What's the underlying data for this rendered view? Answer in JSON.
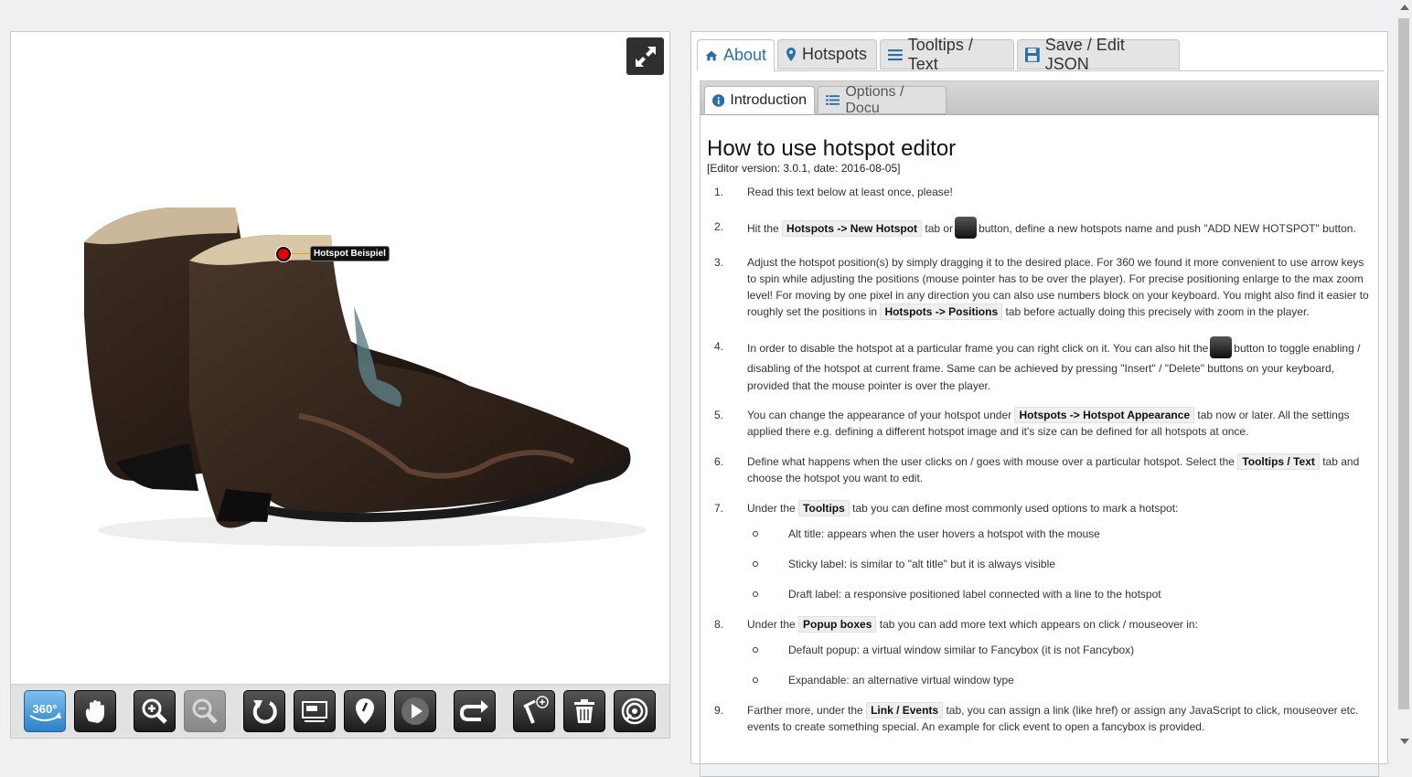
{
  "viewer": {
    "hotspot_label": "Hotspot Beispiel",
    "toolbar": [
      {
        "name": "360-button",
        "icon": "360-icon",
        "active": true
      },
      {
        "name": "pan-button",
        "icon": "hand-icon"
      },
      {
        "name": "zoom-in-button",
        "icon": "zoom-in-icon"
      },
      {
        "name": "zoom-out-button",
        "icon": "zoom-out-icon",
        "disabled": true
      },
      {
        "name": "reset-button",
        "icon": "reset-icon"
      },
      {
        "name": "screen-button",
        "icon": "screen-icon"
      },
      {
        "name": "hotspot-toggle-button",
        "icon": "map-pin-icon"
      },
      {
        "name": "play-button",
        "icon": "play-icon"
      },
      {
        "name": "redo-button",
        "icon": "redo-icon"
      },
      {
        "name": "new-hotspot-button",
        "icon": "add-hotspot-icon"
      },
      {
        "name": "delete-button",
        "icon": "trash-icon"
      },
      {
        "name": "toggle-hotspot-frame-button",
        "icon": "target-icon"
      }
    ]
  },
  "tabs": {
    "main": [
      "About",
      "Hotspots",
      "Tooltips / Text",
      "Save / Edit JSON"
    ],
    "sub": [
      "Introduction",
      "Options / Docu"
    ]
  },
  "content": {
    "title": "How to use hotspot editor",
    "version": "[Editor version: 3.0.1, date: 2016-08-05]",
    "steps": {
      "s1": {
        "num": "1.",
        "text": "Read this text below at least once, please!"
      },
      "s2": {
        "num": "2.",
        "a": "Hit the",
        "kbd": "Hotspots -> New Hotspot",
        "b": "tab or",
        "c": "button, define a new hotspots name and push \"ADD NEW HOTSPOT\" button."
      },
      "s3": {
        "num": "3.",
        "a": "Adjust the hotspot position(s) by simply dragging it to the desired place. For 360 we found it more convenient to use arrow keys to spin while adjusting the positions (mouse pointer has to be over the player). For precise positioning enlarge to the max zoom level! For moving by one pixel in any direction you can also use numbers block on your keyboard. You might also find it easier to roughly set the positions in",
        "kbd": "Hotspots -> Positions",
        "b": "tab before actually doing this precisely with zoom in the player."
      },
      "s4": {
        "num": "4.",
        "a": "In order to disable the hotspot at a particular frame you can right click on it. You can also hit the",
        "b": "button to toggle enabling / disabling of the hotspot at current frame. Same can be achieved by pressing \"Insert\" / \"Delete\" buttons on your keyboard, provided that the mouse pointer is over the player."
      },
      "s5": {
        "num": "5.",
        "a": "You can change the appearance of your hotspot under",
        "kbd": "Hotspots -> Hotspot Appearance",
        "b": "tab now or later. All the settings applied there e.g. defining a different hotspot image and it's size can be defined for all hotspots at once."
      },
      "s6": {
        "num": "6.",
        "a": "Define what happens when the user clicks on / goes with mouse over a particular hotspot. Select the",
        "kbd": "Tooltips / Text",
        "b": "tab and choose the hotspot you want to edit."
      },
      "s7": {
        "num": "7.",
        "a": "Under the",
        "kbd": "Tooltips",
        "b": "tab you can define most commonly used options to mark a hotspot:",
        "subs": [
          "Alt title: appears when the user hovers a hotspot with the mouse",
          "Sticky label: is similar to \"alt title\" but it is always visible",
          "Draft label: a responsive positioned label connected with a line to the hotspot"
        ]
      },
      "s8": {
        "num": "8.",
        "a": "Under the",
        "kbd": "Popup boxes",
        "b": "tab you can add more text which appears on click / mouseover in:",
        "subs": [
          "Default popup: a virtual window similar to Fancybox (it is not Fancybox)",
          "Expandable: an alternative virtual window type"
        ]
      },
      "s9": {
        "num": "9.",
        "a": "Farther more, under the",
        "kbd": "Link / Events",
        "b": "tab, you can assign a link (like href) or assign any JavaScript to click, mouseover etc. events to create something special. An example for click event to open a fancybox is provided."
      }
    }
  }
}
